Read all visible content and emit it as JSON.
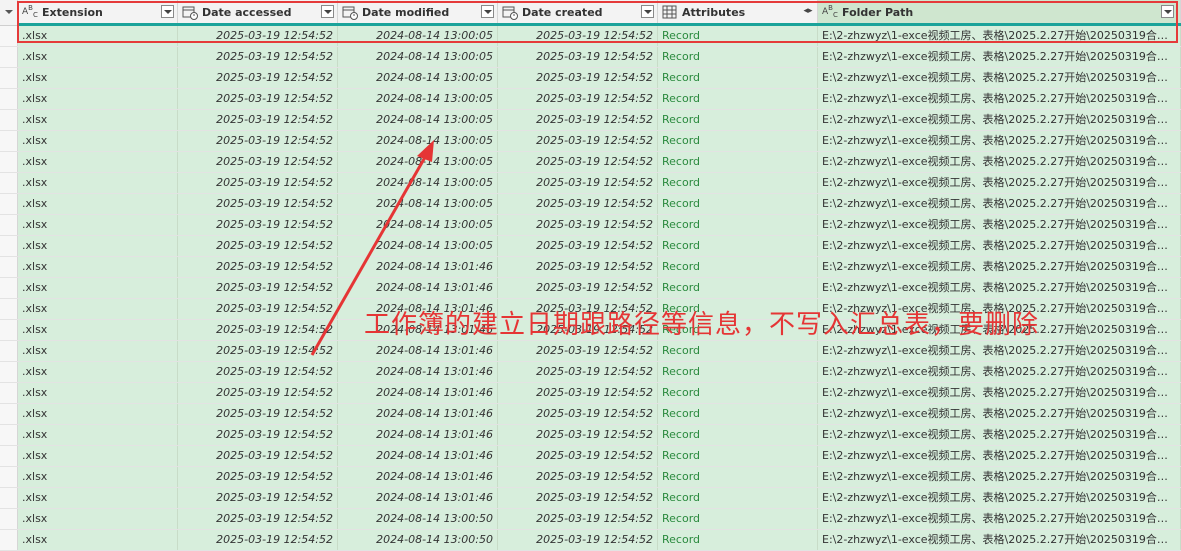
{
  "header": {
    "columns": [
      {
        "label": "Extension",
        "type_icon": "abc-type-icon"
      },
      {
        "label": "Date accessed",
        "type_icon": "datetime-type-icon"
      },
      {
        "label": "Date modified",
        "type_icon": "datetime-type-icon"
      },
      {
        "label": "Date created",
        "type_icon": "datetime-type-icon"
      },
      {
        "label": "Attributes",
        "type_icon": "table-type-icon"
      },
      {
        "label": "Folder Path",
        "type_icon": "abc-type-icon"
      }
    ]
  },
  "rows": [
    {
      "ext": ".xlsx",
      "accessed": "2025-03-19 12:54:52",
      "modified": "2024-08-14 13:00:05",
      "created": "2025-03-19 12:54:52",
      "attr": "Record",
      "path": "E:\\2-zhzwyz\\1-exce视频工房、表格\\2025.2.27开始\\20250319合并…"
    },
    {
      "ext": ".xlsx",
      "accessed": "2025-03-19 12:54:52",
      "modified": "2024-08-14 13:00:05",
      "created": "2025-03-19 12:54:52",
      "attr": "Record",
      "path": "E:\\2-zhzwyz\\1-exce视频工房、表格\\2025.2.27开始\\20250319合并…"
    },
    {
      "ext": ".xlsx",
      "accessed": "2025-03-19 12:54:52",
      "modified": "2024-08-14 13:00:05",
      "created": "2025-03-19 12:54:52",
      "attr": "Record",
      "path": "E:\\2-zhzwyz\\1-exce视频工房、表格\\2025.2.27开始\\20250319合并…"
    },
    {
      "ext": ".xlsx",
      "accessed": "2025-03-19 12:54:52",
      "modified": "2024-08-14 13:00:05",
      "created": "2025-03-19 12:54:52",
      "attr": "Record",
      "path": "E:\\2-zhzwyz\\1-exce视频工房、表格\\2025.2.27开始\\20250319合并…"
    },
    {
      "ext": ".xlsx",
      "accessed": "2025-03-19 12:54:52",
      "modified": "2024-08-14 13:00:05",
      "created": "2025-03-19 12:54:52",
      "attr": "Record",
      "path": "E:\\2-zhzwyz\\1-exce视频工房、表格\\2025.2.27开始\\20250319合并…"
    },
    {
      "ext": ".xlsx",
      "accessed": "2025-03-19 12:54:52",
      "modified": "2024-08-14 13:00:05",
      "created": "2025-03-19 12:54:52",
      "attr": "Record",
      "path": "E:\\2-zhzwyz\\1-exce视频工房、表格\\2025.2.27开始\\20250319合并…"
    },
    {
      "ext": ".xlsx",
      "accessed": "2025-03-19 12:54:52",
      "modified": "2024-08-14 13:00:05",
      "created": "2025-03-19 12:54:52",
      "attr": "Record",
      "path": "E:\\2-zhzwyz\\1-exce视频工房、表格\\2025.2.27开始\\20250319合并…"
    },
    {
      "ext": ".xlsx",
      "accessed": "2025-03-19 12:54:52",
      "modified": "2024-08-14 13:00:05",
      "created": "2025-03-19 12:54:52",
      "attr": "Record",
      "path": "E:\\2-zhzwyz\\1-exce视频工房、表格\\2025.2.27开始\\20250319合并…"
    },
    {
      "ext": ".xlsx",
      "accessed": "2025-03-19 12:54:52",
      "modified": "2024-08-14 13:00:05",
      "created": "2025-03-19 12:54:52",
      "attr": "Record",
      "path": "E:\\2-zhzwyz\\1-exce视频工房、表格\\2025.2.27开始\\20250319合并…"
    },
    {
      "ext": ".xlsx",
      "accessed": "2025-03-19 12:54:52",
      "modified": "2024-08-14 13:00:05",
      "created": "2025-03-19 12:54:52",
      "attr": "Record",
      "path": "E:\\2-zhzwyz\\1-exce视频工房、表格\\2025.2.27开始\\20250319合并…"
    },
    {
      "ext": ".xlsx",
      "accessed": "2025-03-19 12:54:52",
      "modified": "2024-08-14 13:00:05",
      "created": "2025-03-19 12:54:52",
      "attr": "Record",
      "path": "E:\\2-zhzwyz\\1-exce视频工房、表格\\2025.2.27开始\\20250319合并…"
    },
    {
      "ext": ".xlsx",
      "accessed": "2025-03-19 12:54:52",
      "modified": "2024-08-14 13:01:46",
      "created": "2025-03-19 12:54:52",
      "attr": "Record",
      "path": "E:\\2-zhzwyz\\1-exce视频工房、表格\\2025.2.27开始\\20250319合并…"
    },
    {
      "ext": ".xlsx",
      "accessed": "2025-03-19 12:54:52",
      "modified": "2024-08-14 13:01:46",
      "created": "2025-03-19 12:54:52",
      "attr": "Record",
      "path": "E:\\2-zhzwyz\\1-exce视频工房、表格\\2025.2.27开始\\20250319合并…"
    },
    {
      "ext": ".xlsx",
      "accessed": "2025-03-19 12:54:52",
      "modified": "2024-08-14 13:01:46",
      "created": "2025-03-19 12:54:52",
      "attr": "Record",
      "path": "E:\\2-zhzwyz\\1-exce视频工房、表格\\2025.2.27开始\\20250319合并…"
    },
    {
      "ext": ".xlsx",
      "accessed": "2025-03-19 12:54:52",
      "modified": "2024-08-14 13:01:46",
      "created": "2025-03-19 12:54:52",
      "attr": "Record",
      "path": "E:\\2-zhzwyz\\1-exce视频工房、表格\\2025.2.27开始\\20250319合并…"
    },
    {
      "ext": ".xlsx",
      "accessed": "2025-03-19 12:54:52",
      "modified": "2024-08-14 13:01:46",
      "created": "2025-03-19 12:54:52",
      "attr": "Record",
      "path": "E:\\2-zhzwyz\\1-exce视频工房、表格\\2025.2.27开始\\20250319合并…"
    },
    {
      "ext": ".xlsx",
      "accessed": "2025-03-19 12:54:52",
      "modified": "2024-08-14 13:01:46",
      "created": "2025-03-19 12:54:52",
      "attr": "Record",
      "path": "E:\\2-zhzwyz\\1-exce视频工房、表格\\2025.2.27开始\\20250319合并…"
    },
    {
      "ext": ".xlsx",
      "accessed": "2025-03-19 12:54:52",
      "modified": "2024-08-14 13:01:46",
      "created": "2025-03-19 12:54:52",
      "attr": "Record",
      "path": "E:\\2-zhzwyz\\1-exce视频工房、表格\\2025.2.27开始\\20250319合并…"
    },
    {
      "ext": ".xlsx",
      "accessed": "2025-03-19 12:54:52",
      "modified": "2024-08-14 13:01:46",
      "created": "2025-03-19 12:54:52",
      "attr": "Record",
      "path": "E:\\2-zhzwyz\\1-exce视频工房、表格\\2025.2.27开始\\20250319合并…"
    },
    {
      "ext": ".xlsx",
      "accessed": "2025-03-19 12:54:52",
      "modified": "2024-08-14 13:01:46",
      "created": "2025-03-19 12:54:52",
      "attr": "Record",
      "path": "E:\\2-zhzwyz\\1-exce视频工房、表格\\2025.2.27开始\\20250319合并…"
    },
    {
      "ext": ".xlsx",
      "accessed": "2025-03-19 12:54:52",
      "modified": "2024-08-14 13:01:46",
      "created": "2025-03-19 12:54:52",
      "attr": "Record",
      "path": "E:\\2-zhzwyz\\1-exce视频工房、表格\\2025.2.27开始\\20250319合并…"
    },
    {
      "ext": ".xlsx",
      "accessed": "2025-03-19 12:54:52",
      "modified": "2024-08-14 13:01:46",
      "created": "2025-03-19 12:54:52",
      "attr": "Record",
      "path": "E:\\2-zhzwyz\\1-exce视频工房、表格\\2025.2.27开始\\20250319合并…"
    },
    {
      "ext": ".xlsx",
      "accessed": "2025-03-19 12:54:52",
      "modified": "2024-08-14 13:01:46",
      "created": "2025-03-19 12:54:52",
      "attr": "Record",
      "path": "E:\\2-zhzwyz\\1-exce视频工房、表格\\2025.2.27开始\\20250319合并…"
    },
    {
      "ext": ".xlsx",
      "accessed": "2025-03-19 12:54:52",
      "modified": "2024-08-14 13:00:50",
      "created": "2025-03-19 12:54:52",
      "attr": "Record",
      "path": "E:\\2-zhzwyz\\1-exce视频工房、表格\\2025.2.27开始\\20250319合并…"
    },
    {
      "ext": ".xlsx",
      "accessed": "2025-03-19 12:54:52",
      "modified": "2024-08-14 13:00:50",
      "created": "2025-03-19 12:54:52",
      "attr": "Record",
      "path": "E:\\2-zhzwyz\\1-exce视频工房、表格\\2025.2.27开始\\20250319合并…"
    }
  ],
  "annotation": {
    "text": "工作簿的建立日期跟路径等信息，不写入汇总表，要删除",
    "color": "#e53535"
  },
  "colors": {
    "row_fill": "#d7eedc",
    "header_fill": "#f3f3f3",
    "selection_bar": "#1aa39a",
    "record_link": "#2a8a3e"
  }
}
